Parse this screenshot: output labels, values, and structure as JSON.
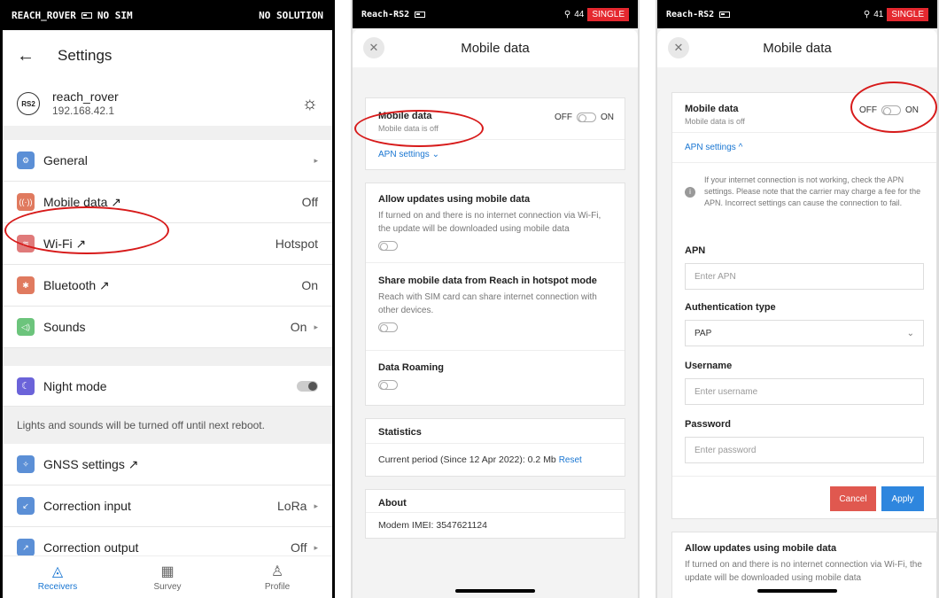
{
  "p1": {
    "status": {
      "device": "REACH_ROVER",
      "sim": "NO SIM",
      "solution": "NO SOLUTION"
    },
    "title": "Settings",
    "device": {
      "badge": "RS2",
      "name": "reach_rover",
      "ip": "192.168.42.1"
    },
    "rows": [
      {
        "label": "General",
        "value": "",
        "icon_color": "#5b8fd6",
        "glyph": "⚙"
      },
      {
        "label": "Mobile data ↗",
        "value": "Off",
        "icon_color": "#e07a5f",
        "glyph": "((·))"
      },
      {
        "label": "Wi-Fi ↗",
        "value": "Hotspot",
        "icon_color": "#e07a7a",
        "glyph": "≋"
      },
      {
        "label": "Bluetooth ↗",
        "value": "On",
        "icon_color": "#e07a5f",
        "glyph": "✱"
      },
      {
        "label": "Sounds",
        "value": "On",
        "icon_color": "#6cc47c",
        "glyph": "◁)"
      }
    ],
    "night_mode": {
      "label": "Night mode",
      "note": "Lights and sounds will be turned off until next reboot."
    },
    "rows2": [
      {
        "label": "GNSS settings ↗",
        "value": "",
        "icon_color": "#5b8fd6",
        "glyph": "✧"
      },
      {
        "label": "Correction input",
        "value": "LoRa",
        "icon_color": "#5b8fd6",
        "glyph": "↙"
      },
      {
        "label": "Correction output",
        "value": "Off",
        "icon_color": "#5b8fd6",
        "glyph": "↗"
      }
    ],
    "nav": [
      {
        "label": "Receivers"
      },
      {
        "label": "Survey"
      },
      {
        "label": "Profile"
      }
    ]
  },
  "p2": {
    "status": {
      "device": "Reach-RS2",
      "sats": "44",
      "mode": "SINGLE"
    },
    "title": "Mobile data",
    "mobile": {
      "title": "Mobile data",
      "sub": "Mobile data is off",
      "off": "OFF",
      "on": "ON",
      "apn": "APN settings ⌄"
    },
    "allow": {
      "title": "Allow updates using mobile data",
      "text": "If turned on and there is no internet connection via Wi-Fi, the update will be downloaded using mobile data"
    },
    "share": {
      "title": "Share mobile data from Reach in hotspot mode",
      "text": "Reach with SIM card can share internet connection with other devices."
    },
    "roaming": {
      "title": "Data Roaming"
    },
    "stats": {
      "title": "Statistics",
      "text": "Current period (Since 12 Apr 2022): 0.2 Mb",
      "reset": "Reset"
    },
    "about": {
      "title": "About",
      "text": "Modem IMEI: 3547621124"
    }
  },
  "p3": {
    "status": {
      "device": "Reach-RS2",
      "sats": "41",
      "mode": "SINGLE"
    },
    "title": "Mobile data",
    "mobile": {
      "title": "Mobile data",
      "sub": "Mobile data is off",
      "off": "OFF",
      "on": "ON",
      "apn": "APN settings ^"
    },
    "info": "If your internet connection is not working, check the APN settings. Please note that the carrier may charge a fee for the APN. Incorrect settings can cause the connection to fail.",
    "apn_label": "APN",
    "apn_ph": "Enter APN",
    "auth_label": "Authentication type",
    "auth_value": "PAP",
    "user_label": "Username",
    "user_ph": "Enter username",
    "pass_label": "Password",
    "pass_ph": "Enter password",
    "cancel": "Cancel",
    "apply": "Apply",
    "allow": {
      "title": "Allow updates using mobile data",
      "text": "If turned on and there is no internet connection via Wi-Fi, the update will be downloaded using mobile data"
    }
  }
}
